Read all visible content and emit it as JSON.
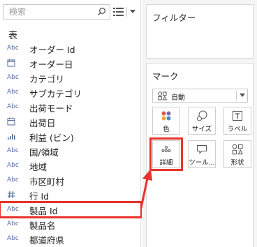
{
  "search": {
    "placeholder": "検索"
  },
  "data_pane": {
    "section_title": "表",
    "fields": [
      {
        "type": "Abc",
        "name": "オーダー Id",
        "icon": "string-type-icon"
      },
      {
        "type": "",
        "name": "オーダー日",
        "icon": "date-type-icon"
      },
      {
        "type": "Abc",
        "name": "カテゴリ",
        "icon": "string-type-icon"
      },
      {
        "type": "Abc",
        "name": "サブカテゴリ",
        "icon": "string-type-icon"
      },
      {
        "type": "Abc",
        "name": "出荷モード",
        "icon": "string-type-icon"
      },
      {
        "type": "",
        "name": "出荷日",
        "icon": "date-type-icon"
      },
      {
        "type": "",
        "name": "利益 (ビン)",
        "icon": "bin-type-icon"
      },
      {
        "type": "",
        "name": "国/領域",
        "icon": "globe-type-icon"
      },
      {
        "type": "",
        "name": "地域",
        "icon": "globe-type-icon"
      },
      {
        "type": "",
        "name": "市区町村",
        "icon": "globe-type-icon"
      },
      {
        "type": "",
        "name": "行 Id",
        "icon": "number-type-icon"
      },
      {
        "type": "Abc",
        "name": "製品 Id",
        "icon": "string-type-icon",
        "highlighted": true
      },
      {
        "type": "Abc",
        "name": "製品名",
        "icon": "string-type-icon"
      },
      {
        "type": "",
        "name": "都道府県",
        "icon": "globe-type-icon"
      }
    ]
  },
  "filters_card": {
    "title": "フィルター"
  },
  "marks_card": {
    "title": "マーク",
    "mark_type": "自動",
    "buttons": {
      "color": "色",
      "size": "サイズ",
      "label": "ラベル",
      "detail": "詳細",
      "tooltip": "ツール...",
      "shape": "形状"
    }
  },
  "colors": {
    "highlight": "#e8332a",
    "type_icon": "#4f6a9a"
  }
}
